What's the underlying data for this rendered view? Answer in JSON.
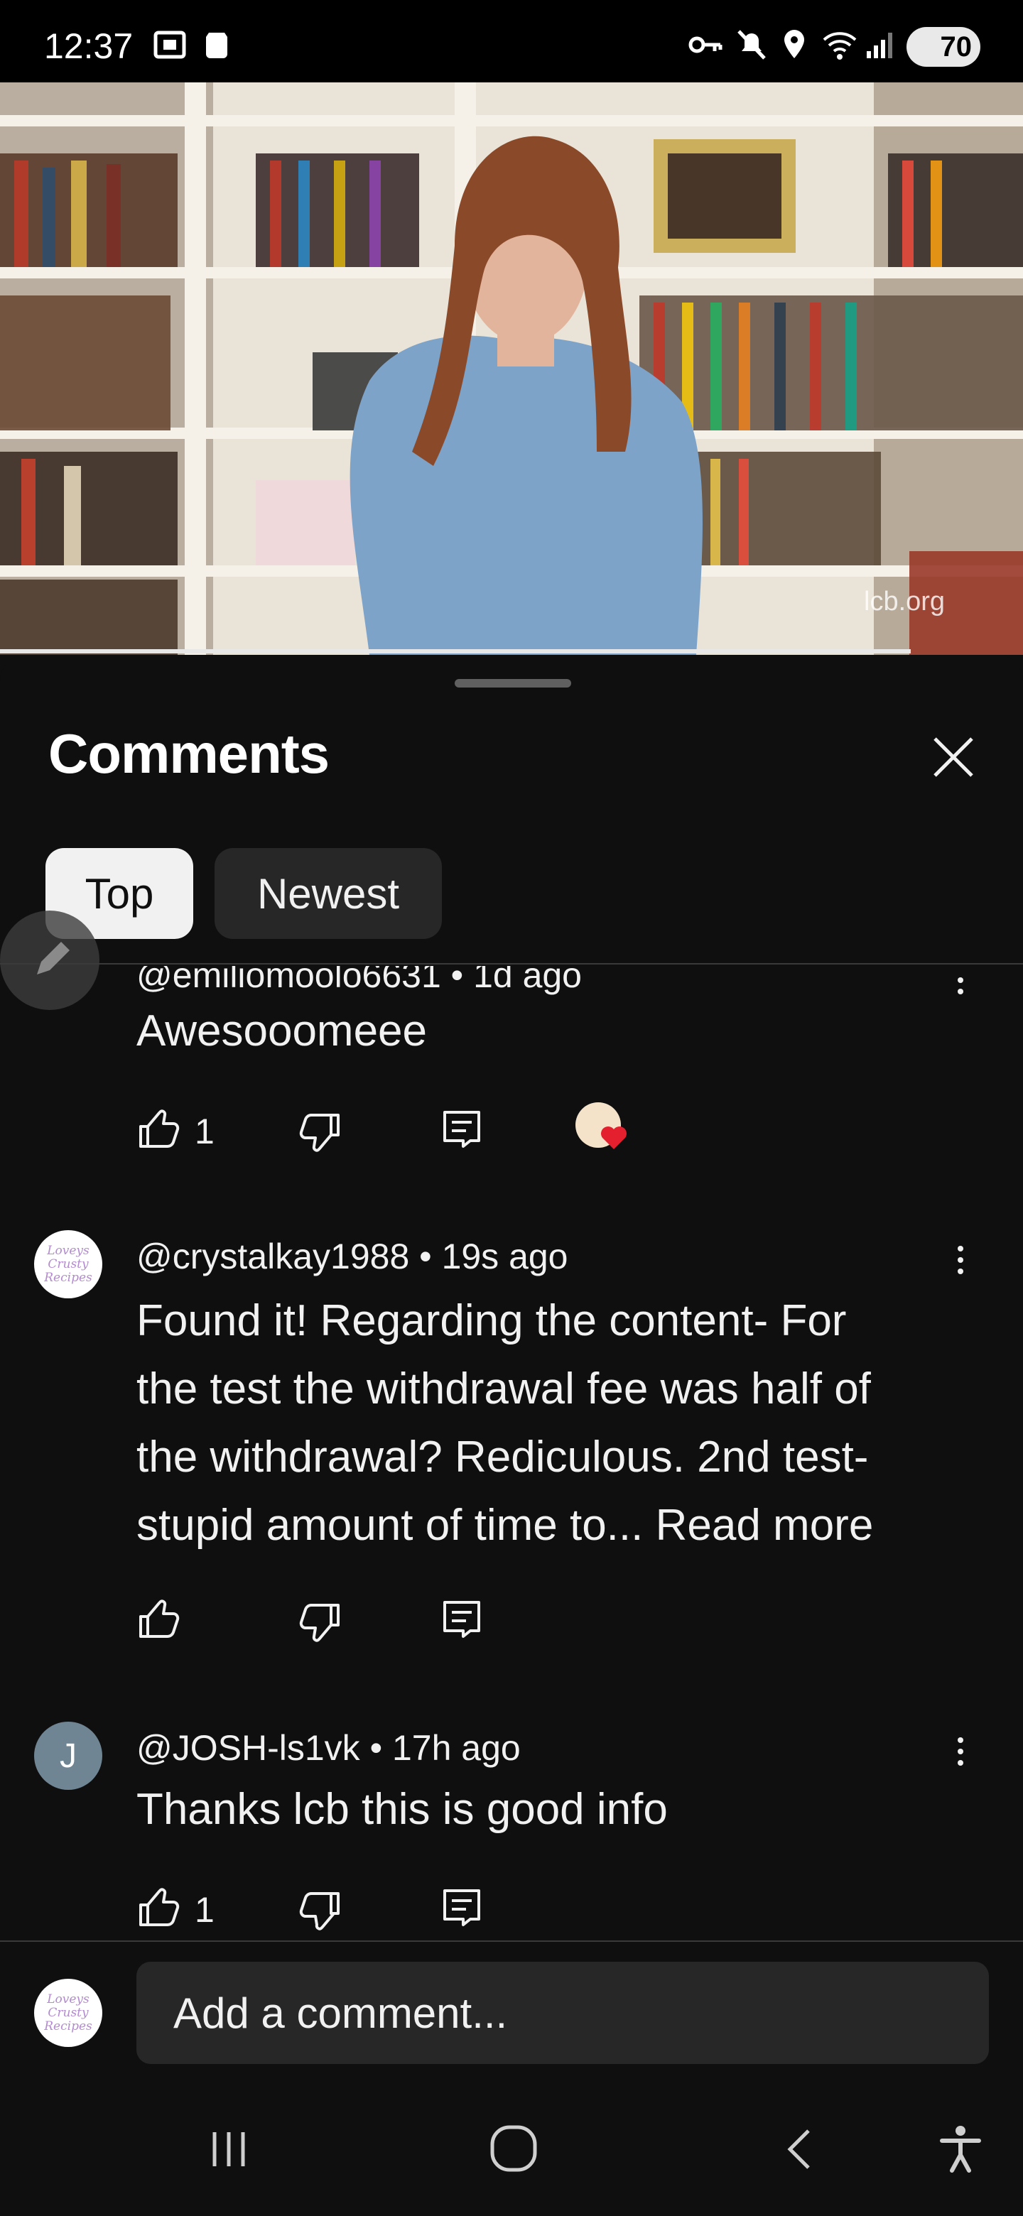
{
  "status_bar": {
    "time": "12:37",
    "battery": "70",
    "icons": [
      "screenshot-icon",
      "notification-icon",
      "vpn-key-icon",
      "mute-icon",
      "location-icon",
      "wifi-icon",
      "signal-icon",
      "battery-icon"
    ]
  },
  "video": {
    "watermark": "lcb.org",
    "progress": 0.89
  },
  "comments_panel": {
    "title": "Comments",
    "filters": [
      "Top",
      "Newest"
    ],
    "selected_filter": "Top"
  },
  "comments": [
    {
      "author": "@emiliomoolo6631",
      "age": "1d ago",
      "text": "Awesooomeee",
      "likes": "1",
      "creator_heart": true
    },
    {
      "author": "@crystalkay1988",
      "age": "19s ago",
      "text_lines": [
        "Found it! Regarding the content- For",
        "the test the withdrawal fee was half of",
        "the withdrawal? Rediculous. 2nd test-",
        "stupid amount of time to..."
      ],
      "read_more": "Read more",
      "likes": "",
      "avatar_text": [
        "Loveys",
        "Crusty",
        "Recipes"
      ]
    },
    {
      "author": "@JOSH-ls1vk",
      "age": "17h ago",
      "text": "Thanks lcb this is good info",
      "likes": "1",
      "avatar_letter": "J"
    }
  ],
  "composer": {
    "placeholder": "Add a comment...",
    "avatar_text": [
      "Loveys",
      "Crusty",
      "Recipes"
    ]
  },
  "colors": {
    "background": "#0f0f0f",
    "chip_selected": "#f1f1f1",
    "chip_unselected": "#272727",
    "heart": "#e5202e"
  }
}
